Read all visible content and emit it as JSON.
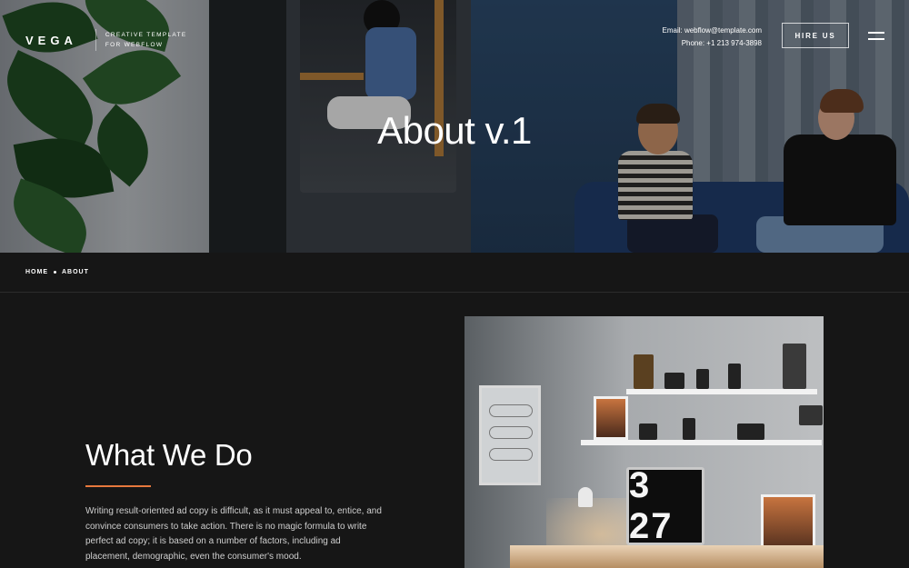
{
  "brand": {
    "name": "VEGA",
    "tagline_line1": "CREATIVE TEMPLATE",
    "tagline_line2": "FOR WEBFLOW"
  },
  "contact": {
    "email_line": "Email:  webflow@template.com",
    "phone_line": "Phone: +1 213 974-3898"
  },
  "nav": {
    "hire_label": "HIRE US",
    "menu_icon": "hamburger-menu-icon"
  },
  "hero": {
    "title": "About v.1"
  },
  "breadcrumb": {
    "items": [
      "HOME",
      "ABOUT"
    ]
  },
  "section": {
    "title": "What We Do",
    "body": "Writing result-oriented ad copy is difficult, as it must appeal to, entice, and convince consumers to take action. There is no magic formula to write perfect ad copy; it is based on a number of factors, including ad placement, demographic, even the consumer's mood.",
    "accent_color": "#e7793d"
  },
  "office_image": {
    "clock_text": "3 27"
  }
}
